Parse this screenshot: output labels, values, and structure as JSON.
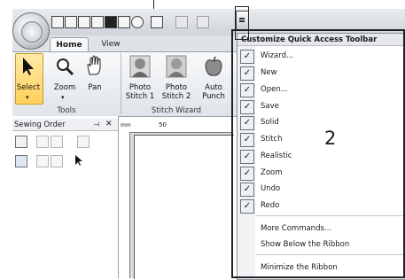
{
  "tabs": [
    "Home",
    "View"
  ],
  "ribbon": {
    "buttons": [
      {
        "label_line1": "Select",
        "label_line2": ""
      },
      {
        "label_line1": "Zoom",
        "label_line2": ""
      },
      {
        "label_line1": "Pan",
        "label_line2": ""
      },
      {
        "label_line1": "Photo",
        "label_line2": "Stitch 1"
      },
      {
        "label_line1": "Photo",
        "label_line2": "Stitch 2"
      },
      {
        "label_line1": "Auto",
        "label_line2": "Punch"
      }
    ],
    "groups": [
      "Tools",
      "Stitch Wizard"
    ]
  },
  "panel": {
    "title": "Sewing Order",
    "pin": "д",
    "close": "✕"
  },
  "ruler": {
    "unit": "mm",
    "tick_label": "50"
  },
  "menu": {
    "title": "Customize Quick Access Toolbar",
    "items": [
      {
        "label": "Wizard...",
        "checked": true
      },
      {
        "label": "New",
        "checked": true
      },
      {
        "label": "Open...",
        "checked": true
      },
      {
        "label": "Save",
        "checked": true
      },
      {
        "label": "Solid",
        "checked": true
      },
      {
        "label": "Stitch",
        "checked": true
      },
      {
        "label": "Realistic",
        "checked": true
      },
      {
        "label": "Zoom",
        "checked": true
      },
      {
        "label": "Undo",
        "checked": true
      },
      {
        "label": "Redo",
        "checked": true
      }
    ],
    "extra": [
      "More Commands...",
      "Show Below the Ribbon",
      "Minimize the Ribbon"
    ]
  },
  "annotation": "2",
  "checkmark": "✓"
}
